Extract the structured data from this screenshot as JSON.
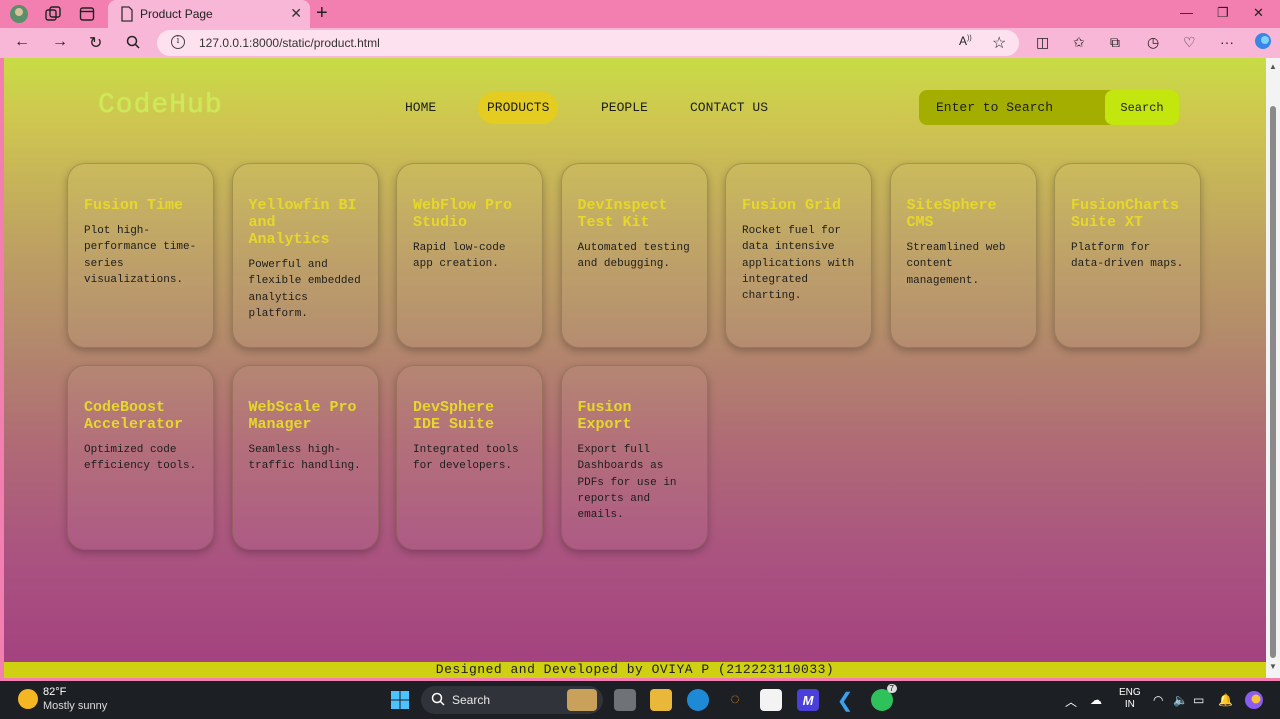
{
  "browser": {
    "tab_title": "Product Page",
    "url": "127.0.0.1:8000/static/product.html",
    "tab_close_glyph": "✕",
    "new_tab_glyph": "+"
  },
  "site": {
    "logo": "CodeHub",
    "nav": [
      "HOME",
      "PRODUCTS",
      "PEOPLE",
      "CONTACT US"
    ],
    "active_nav": "PRODUCTS",
    "search_placeholder": "Enter to Search",
    "search_button": "Search",
    "footer": "Designed and Developed by OVIYA P (212223110033)",
    "colors": {
      "logo": "#cde95a",
      "card_title": "#e6d82a",
      "active_nav_bg": "#e5cc20",
      "search_bg": "#a4ae00",
      "search_button_bg": "#c4e60f",
      "footer_bg": "#cfd011"
    }
  },
  "products": [
    {
      "title": "Fusion Time",
      "desc": "Plot high-performance time-series visualizations."
    },
    {
      "title": "Yellowfin BI and Analytics",
      "desc": "Powerful and flexible embedded analytics platform."
    },
    {
      "title": "WebFlow Pro Studio",
      "desc": "Rapid low-code app creation."
    },
    {
      "title": "DevInspect Test Kit",
      "desc": "Automated testing and debugging."
    },
    {
      "title": "Fusion Grid",
      "desc": "Rocket fuel for data intensive applications with integrated charting."
    },
    {
      "title": "SiteSphere CMS",
      "desc": "Streamlined web content management."
    },
    {
      "title": "FusionCharts Suite XT",
      "desc": "Platform for data-driven maps."
    },
    {
      "title": "CodeBoost Accelerator",
      "desc": "Optimized code efficiency tools."
    },
    {
      "title": "WebScale Pro Manager",
      "desc": "Seamless high-traffic handling."
    },
    {
      "title": "DevSphere IDE Suite",
      "desc": "Integrated tools for developers."
    },
    {
      "title": "Fusion Export",
      "desc": "Export full Dashboards as PDFs for use in reports and emails."
    }
  ],
  "taskbar": {
    "temperature": "82°F",
    "weather": "Mostly sunny",
    "search": "Search",
    "lang_line1": "ENG",
    "lang_line2": "IN",
    "whatsapp_badge": "7"
  }
}
